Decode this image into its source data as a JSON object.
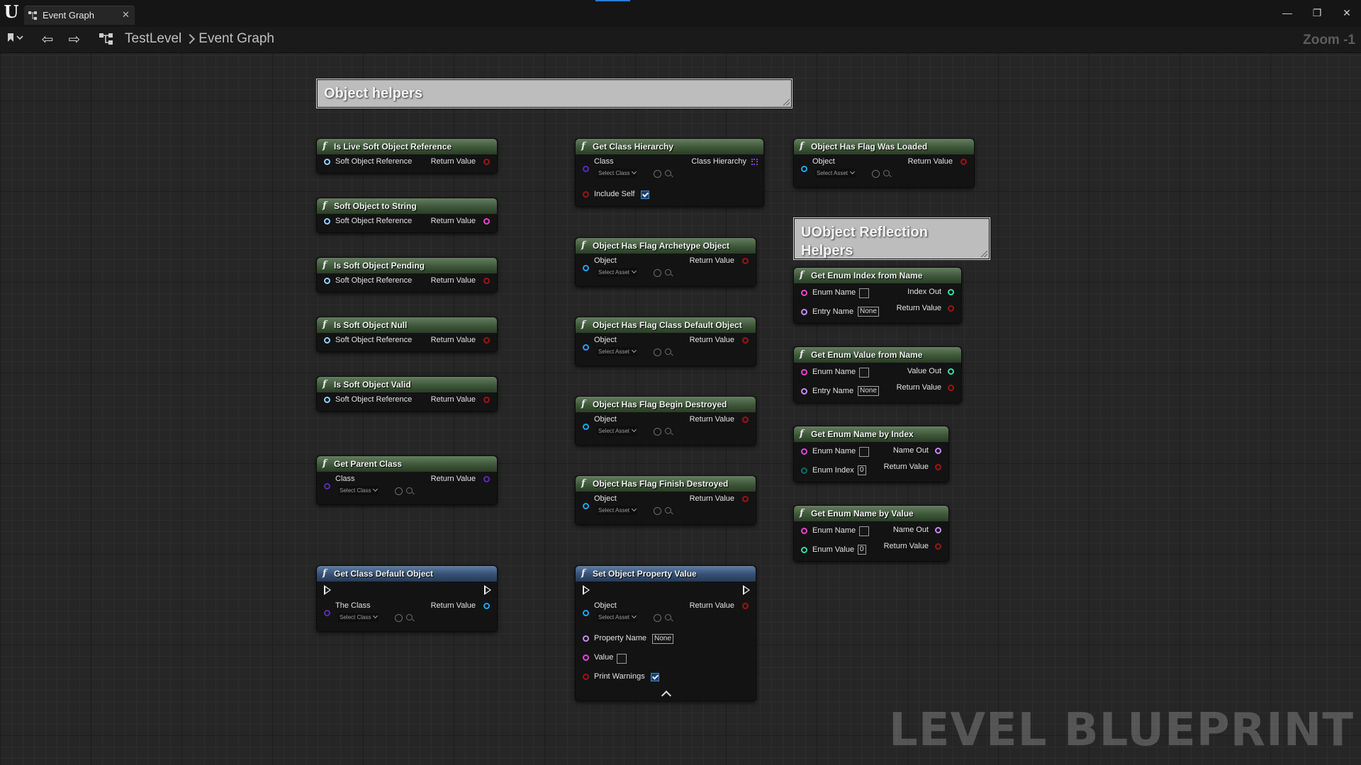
{
  "window": {
    "tab_title": "Event Graph",
    "tab_close": "✕",
    "minimize": "—",
    "restore": "❐",
    "close": "✕"
  },
  "toolbar": {
    "back_glyph": "⇦",
    "forward_glyph": "⇨",
    "breadcrumb": [
      "TestLevel",
      "Event Graph"
    ],
    "zoom_label": "Zoom -1"
  },
  "comments": {
    "object_helpers": "Object helpers",
    "reflection_helpers": "UObject Reflection Helpers"
  },
  "watermark": "LEVEL BLUEPRINT",
  "nodes": {
    "is_live": {
      "title": "Is Live Soft Object Reference",
      "in": "Soft Object Reference",
      "out": "Return Value"
    },
    "to_string": {
      "title": "Soft Object to String",
      "in": "Soft Object Reference",
      "out": "Return Value"
    },
    "pending": {
      "title": "Is Soft Object Pending",
      "in": "Soft Object Reference",
      "out": "Return Value"
    },
    "null": {
      "title": "Is Soft Object Null",
      "in": "Soft Object Reference",
      "out": "Return Value"
    },
    "valid": {
      "title": "Is Soft Object Valid",
      "in": "Soft Object Reference",
      "out": "Return Value"
    },
    "parent_class": {
      "title": "Get Parent Class",
      "in": "Class",
      "combo": "Select Class",
      "out": "Return Value"
    },
    "class_default": {
      "title": "Get Class Default Object",
      "in": "The Class",
      "combo": "Select Class",
      "out": "Return Value"
    },
    "class_hierarchy": {
      "title": "Get Class Hierarchy",
      "in": "Class",
      "combo": "Select Class",
      "include_self": "Include Self",
      "out": "Class Hierarchy"
    },
    "flag_archetype": {
      "title": "Object Has Flag Archetype Object",
      "in": "Object",
      "combo": "Select Asset",
      "out": "Return Value"
    },
    "flag_cdo": {
      "title": "Object Has Flag Class Default Object",
      "in": "Object",
      "combo": "Select Asset",
      "out": "Return Value"
    },
    "flag_begin_destroyed": {
      "title": "Object Has Flag Begin Destroyed",
      "in": "Object",
      "combo": "Select Asset",
      "out": "Return Value"
    },
    "flag_finish_destroyed": {
      "title": "Object Has Flag Finish Destroyed",
      "in": "Object",
      "combo": "Select Asset",
      "out": "Return Value"
    },
    "set_property": {
      "title": "Set Object Property Value",
      "in": "Object",
      "combo": "Select Asset",
      "out": "Return Value",
      "property_name": "Property Name",
      "property_value": "None",
      "value": "Value",
      "print_warnings": "Print Warnings"
    },
    "flag_loaded": {
      "title": "Object Has Flag Was Loaded",
      "in": "Object",
      "combo": "Select Asset",
      "out": "Return Value"
    },
    "enum_index_from_name": {
      "title": "Get Enum Index from Name",
      "enum_name": "Enum Name",
      "entry_name": "Entry Name",
      "entry_value": "None",
      "out1": "Index Out",
      "out2": "Return Value"
    },
    "enum_value_from_name": {
      "title": "Get Enum Value from Name",
      "enum_name": "Enum Name",
      "entry_name": "Entry Name",
      "entry_value": "None",
      "out1": "Value Out",
      "out2": "Return Value"
    },
    "enum_name_by_index": {
      "title": "Get Enum Name by Index",
      "enum_name": "Enum Name",
      "enum_index": "Enum Index",
      "index_value": "0",
      "out1": "Name Out",
      "out2": "Return Value"
    },
    "enum_name_by_value": {
      "title": "Get Enum Name by Value",
      "enum_name": "Enum Name",
      "enum_value": "Enum Value",
      "value_value": "0",
      "out1": "Name Out",
      "out2": "Return Value"
    }
  },
  "colors": {
    "pure_header": "#3d5738",
    "impure_header": "#354f73",
    "soft_ref_pin": "#8fd2ff",
    "bool_pin": "#9d1515",
    "string_pin": "#f33ed6",
    "class_pin": "#5a2bb6",
    "object_pin": "#1aa9ef",
    "name_pin": "#c98cf4",
    "byte_pin": "#0a6e62",
    "int_pin": "#2ee2a6"
  }
}
